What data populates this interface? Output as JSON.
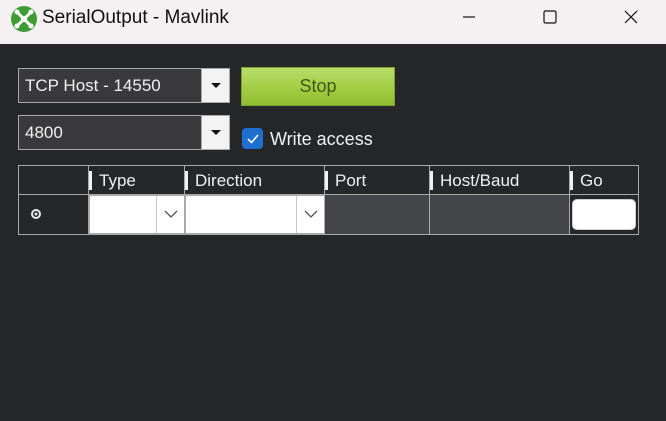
{
  "window": {
    "title": "SerialOutput - Mavlink",
    "icon": "mission-planner-icon",
    "controls": [
      "minimize-icon",
      "maximize-icon",
      "close-icon"
    ]
  },
  "connection": {
    "selected": "TCP Host - 14550"
  },
  "baud": {
    "selected": "4800"
  },
  "stop_button": {
    "label": "Stop"
  },
  "write_access": {
    "label": "Write access",
    "checked": true
  },
  "grid": {
    "columns": [
      "Type",
      "Direction",
      "Port",
      "Host/Baud",
      "Go"
    ],
    "rows": [
      {
        "type": "",
        "direction": "",
        "port": "",
        "host_baud": "",
        "go": ""
      }
    ]
  },
  "colors": {
    "background": "#262729",
    "titlebar": "#f5f0f2",
    "stop_button": "#a6d14a",
    "checkbox": "#1f6fd1"
  }
}
